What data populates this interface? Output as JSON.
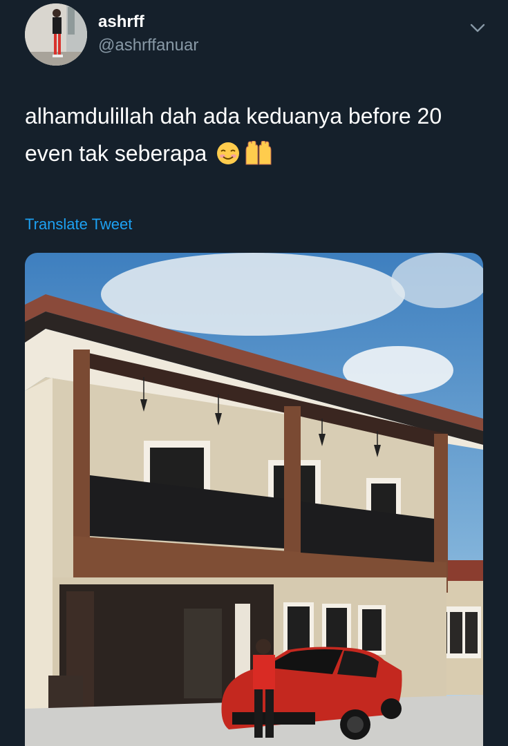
{
  "author": {
    "display_name": "ashrff",
    "handle": "@ashrffanuar",
    "avatar_icon": "profile-photo"
  },
  "tweet": {
    "text": "alhamdulillah dah ada keduanya before 20 even tak seberapa",
    "emojis": [
      "smiling-face-icon",
      "raised-hands-icon"
    ],
    "translate_label": "Translate Tweet"
  },
  "menu_icon": "chevron-down-icon",
  "colors": {
    "background": "#15202b",
    "text": "#ffffff",
    "secondary_text": "#8899a6",
    "link": "#1da1f2"
  }
}
